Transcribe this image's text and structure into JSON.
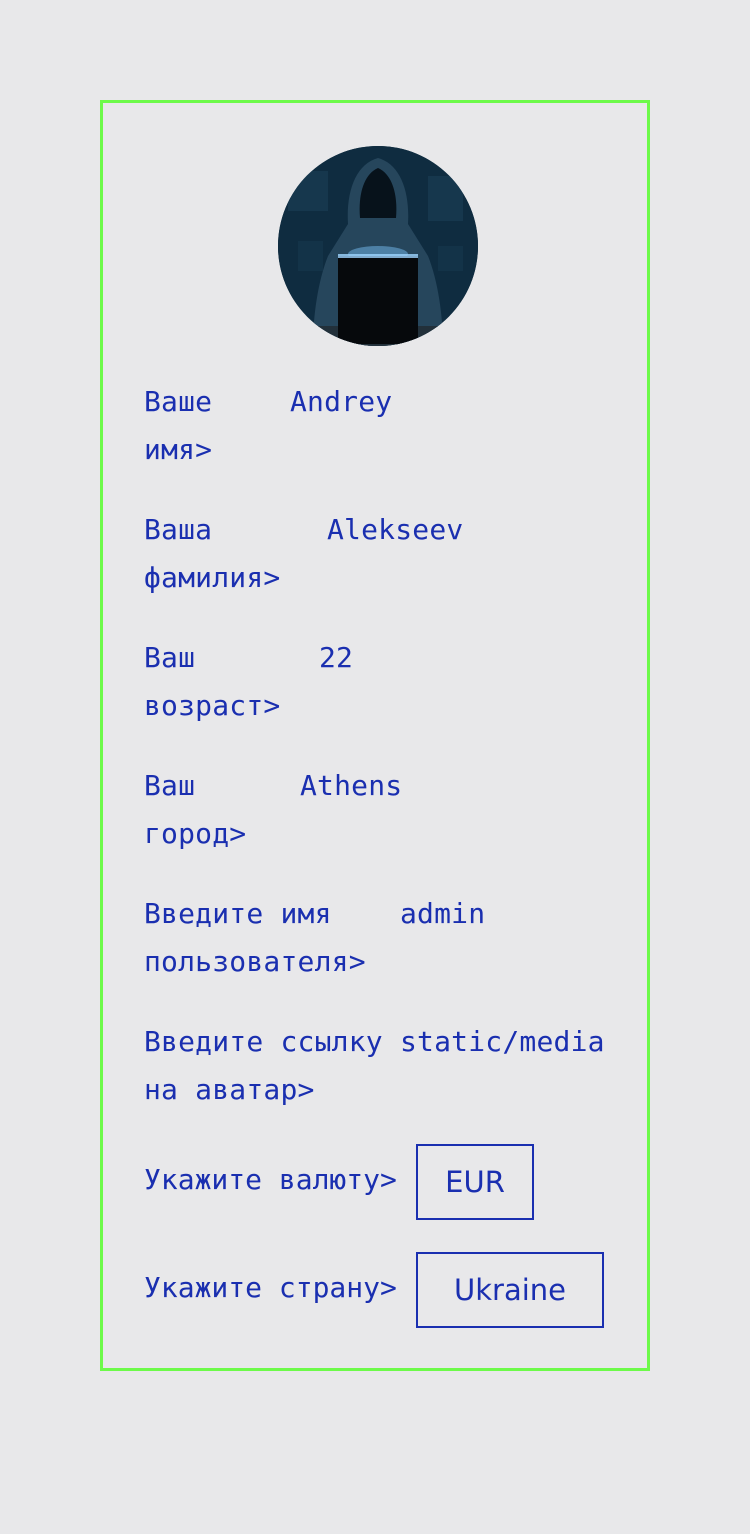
{
  "profile": {
    "avatar_icon": "hooded-hacker-avatar",
    "fields": [
      {
        "label": "Ваше\nимя>",
        "value": "Andrey"
      },
      {
        "label": "Ваша\nфамилия>",
        "value": "Alekseev"
      },
      {
        "label": "Ваш\nвозраст>",
        "value": "22"
      },
      {
        "label": "Ваш\nгород>",
        "value": "Athens"
      },
      {
        "label": "Введите имя\nпользователя>",
        "value": "admin"
      },
      {
        "label": "Введите ссылку\nна аватар>",
        "value": "static/media"
      }
    ],
    "currency": {
      "label": "Укажите валюту>",
      "value": "EUR"
    },
    "country": {
      "label": "Укажите страну>",
      "value": "Ukraine"
    }
  },
  "colors": {
    "background": "#e8e8ea",
    "text": "#1a2fb0",
    "card_border": "#6dfa4a"
  }
}
